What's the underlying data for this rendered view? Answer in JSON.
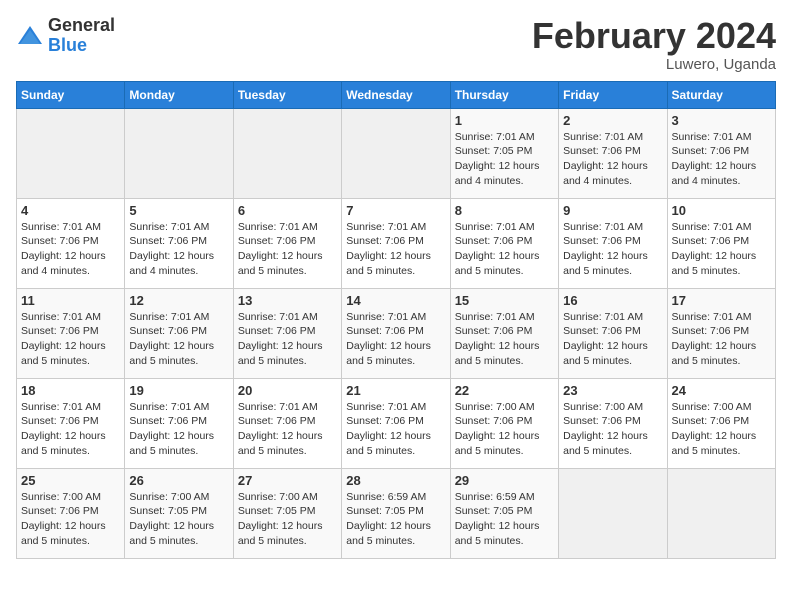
{
  "logo": {
    "general": "General",
    "blue": "Blue"
  },
  "title": "February 2024",
  "location": "Luwero, Uganda",
  "days_of_week": [
    "Sunday",
    "Monday",
    "Tuesday",
    "Wednesday",
    "Thursday",
    "Friday",
    "Saturday"
  ],
  "weeks": [
    [
      {
        "num": "",
        "info": ""
      },
      {
        "num": "",
        "info": ""
      },
      {
        "num": "",
        "info": ""
      },
      {
        "num": "",
        "info": ""
      },
      {
        "num": "1",
        "info": "Sunrise: 7:01 AM\nSunset: 7:05 PM\nDaylight: 12 hours\nand 4 minutes."
      },
      {
        "num": "2",
        "info": "Sunrise: 7:01 AM\nSunset: 7:06 PM\nDaylight: 12 hours\nand 4 minutes."
      },
      {
        "num": "3",
        "info": "Sunrise: 7:01 AM\nSunset: 7:06 PM\nDaylight: 12 hours\nand 4 minutes."
      }
    ],
    [
      {
        "num": "4",
        "info": "Sunrise: 7:01 AM\nSunset: 7:06 PM\nDaylight: 12 hours\nand 4 minutes."
      },
      {
        "num": "5",
        "info": "Sunrise: 7:01 AM\nSunset: 7:06 PM\nDaylight: 12 hours\nand 4 minutes."
      },
      {
        "num": "6",
        "info": "Sunrise: 7:01 AM\nSunset: 7:06 PM\nDaylight: 12 hours\nand 5 minutes."
      },
      {
        "num": "7",
        "info": "Sunrise: 7:01 AM\nSunset: 7:06 PM\nDaylight: 12 hours\nand 5 minutes."
      },
      {
        "num": "8",
        "info": "Sunrise: 7:01 AM\nSunset: 7:06 PM\nDaylight: 12 hours\nand 5 minutes."
      },
      {
        "num": "9",
        "info": "Sunrise: 7:01 AM\nSunset: 7:06 PM\nDaylight: 12 hours\nand 5 minutes."
      },
      {
        "num": "10",
        "info": "Sunrise: 7:01 AM\nSunset: 7:06 PM\nDaylight: 12 hours\nand 5 minutes."
      }
    ],
    [
      {
        "num": "11",
        "info": "Sunrise: 7:01 AM\nSunset: 7:06 PM\nDaylight: 12 hours\nand 5 minutes."
      },
      {
        "num": "12",
        "info": "Sunrise: 7:01 AM\nSunset: 7:06 PM\nDaylight: 12 hours\nand 5 minutes."
      },
      {
        "num": "13",
        "info": "Sunrise: 7:01 AM\nSunset: 7:06 PM\nDaylight: 12 hours\nand 5 minutes."
      },
      {
        "num": "14",
        "info": "Sunrise: 7:01 AM\nSunset: 7:06 PM\nDaylight: 12 hours\nand 5 minutes."
      },
      {
        "num": "15",
        "info": "Sunrise: 7:01 AM\nSunset: 7:06 PM\nDaylight: 12 hours\nand 5 minutes."
      },
      {
        "num": "16",
        "info": "Sunrise: 7:01 AM\nSunset: 7:06 PM\nDaylight: 12 hours\nand 5 minutes."
      },
      {
        "num": "17",
        "info": "Sunrise: 7:01 AM\nSunset: 7:06 PM\nDaylight: 12 hours\nand 5 minutes."
      }
    ],
    [
      {
        "num": "18",
        "info": "Sunrise: 7:01 AM\nSunset: 7:06 PM\nDaylight: 12 hours\nand 5 minutes."
      },
      {
        "num": "19",
        "info": "Sunrise: 7:01 AM\nSunset: 7:06 PM\nDaylight: 12 hours\nand 5 minutes."
      },
      {
        "num": "20",
        "info": "Sunrise: 7:01 AM\nSunset: 7:06 PM\nDaylight: 12 hours\nand 5 minutes."
      },
      {
        "num": "21",
        "info": "Sunrise: 7:01 AM\nSunset: 7:06 PM\nDaylight: 12 hours\nand 5 minutes."
      },
      {
        "num": "22",
        "info": "Sunrise: 7:00 AM\nSunset: 7:06 PM\nDaylight: 12 hours\nand 5 minutes."
      },
      {
        "num": "23",
        "info": "Sunrise: 7:00 AM\nSunset: 7:06 PM\nDaylight: 12 hours\nand 5 minutes."
      },
      {
        "num": "24",
        "info": "Sunrise: 7:00 AM\nSunset: 7:06 PM\nDaylight: 12 hours\nand 5 minutes."
      }
    ],
    [
      {
        "num": "25",
        "info": "Sunrise: 7:00 AM\nSunset: 7:06 PM\nDaylight: 12 hours\nand 5 minutes."
      },
      {
        "num": "26",
        "info": "Sunrise: 7:00 AM\nSunset: 7:05 PM\nDaylight: 12 hours\nand 5 minutes."
      },
      {
        "num": "27",
        "info": "Sunrise: 7:00 AM\nSunset: 7:05 PM\nDaylight: 12 hours\nand 5 minutes."
      },
      {
        "num": "28",
        "info": "Sunrise: 6:59 AM\nSunset: 7:05 PM\nDaylight: 12 hours\nand 5 minutes."
      },
      {
        "num": "29",
        "info": "Sunrise: 6:59 AM\nSunset: 7:05 PM\nDaylight: 12 hours\nand 5 minutes."
      },
      {
        "num": "",
        "info": ""
      },
      {
        "num": "",
        "info": ""
      }
    ]
  ]
}
